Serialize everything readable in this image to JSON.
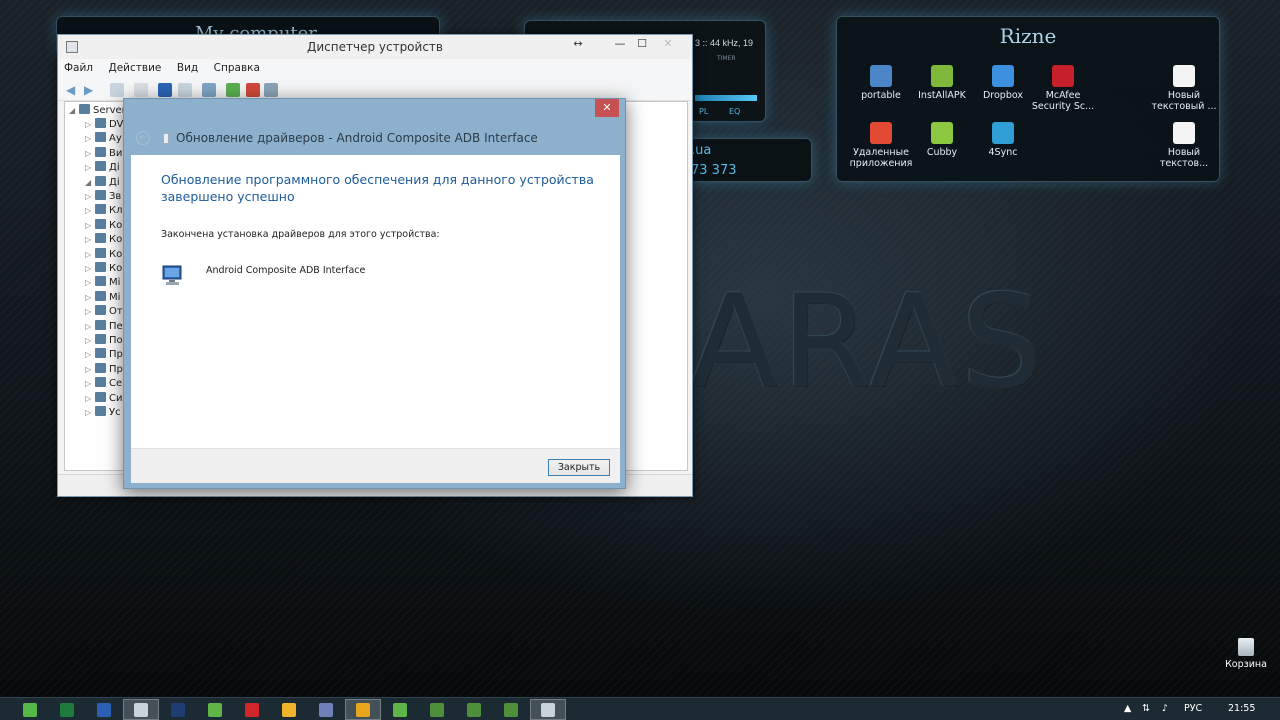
{
  "desktop": {
    "wallpaper_text": "ARAS",
    "recycle_bin_label": "Корзина"
  },
  "gadgets": {
    "my_computer_title": "My computer",
    "player": {
      "info": "3 :: 44 kHz, 19",
      "timer": "TIMER",
      "pl": "PL",
      "eq": "EQ"
    },
    "site": {
      "line1": ".ua",
      "line2": "73 373"
    },
    "rizne": {
      "title": "Rizne",
      "items": [
        {
          "label": "portable",
          "icon": "portable-icon",
          "color": "#4a86c8"
        },
        {
          "label": "InstAllAPK",
          "icon": "installapk-icon",
          "color": "#7fb83a"
        },
        {
          "label": "Dropbox",
          "icon": "dropbox-icon",
          "color": "#3d8fe0"
        },
        {
          "label": "McAfee Security Sc...",
          "icon": "mcafee-icon",
          "color": "#c8202a"
        },
        {
          "label": "Новый текстовый ...",
          "icon": "text-file-icon",
          "color": "#f4f4f4"
        },
        {
          "label": "Удаленные приложения",
          "icon": "chrome-icon",
          "color": "#e24a33"
        },
        {
          "label": "Cubby",
          "icon": "cubby-icon",
          "color": "#8dc63f"
        },
        {
          "label": "4Sync",
          "icon": "4sync-icon",
          "color": "#2f9fd6"
        },
        {
          "label": "Новый текстов...",
          "icon": "text-file-icon",
          "color": "#f4f4f4"
        }
      ]
    }
  },
  "devmgr": {
    "title": "Диспетчер устройств",
    "menu": [
      "Файл",
      "Действие",
      "Вид",
      "Справка"
    ],
    "tree_root": "Server",
    "tree_rows": [
      "DV",
      "Ау",
      "Ви",
      "Ді",
      "Ді",
      "Зв",
      "Кл",
      "Ко",
      "Ко",
      "Ко",
      "Ко",
      "Мі",
      "Мі",
      "От",
      "Пе",
      "По",
      "Пр",
      "Пр",
      "Се",
      "Си",
      "Ус"
    ]
  },
  "dialog": {
    "title": "Обновление драйверов - Android Composite ADB Interface",
    "heading": "Обновление программного обеспечения для данного устройства завершено успешно",
    "info": "Закончена установка драйверов для этого устройства:",
    "device_name": "Android Composite ADB Interface",
    "close_button": "Закрыть",
    "close_glyph": "✕"
  },
  "taskbar": {
    "apps": [
      {
        "icon": "utorrent-icon",
        "color": "#56b847"
      },
      {
        "icon": "excel-icon",
        "color": "#1f7a3e"
      },
      {
        "icon": "word-icon",
        "color": "#2b5fb4"
      },
      {
        "icon": "device-manager-icon",
        "color": "#c9d3da",
        "active": true
      },
      {
        "icon": "photoshop-icon",
        "color": "#1d3d73"
      },
      {
        "icon": "gear-green-icon",
        "color": "#5fb546"
      },
      {
        "icon": "opera-icon",
        "color": "#d3262b"
      },
      {
        "icon": "chrome-icon",
        "color": "#f1b32c"
      },
      {
        "icon": "save-icon",
        "color": "#6f7fb8"
      },
      {
        "icon": "avast-icon",
        "color": "#e7a61b",
        "active": true
      },
      {
        "icon": "gear-green-icon",
        "color": "#5fb546"
      },
      {
        "icon": "filezilla-icon",
        "color": "#4f8f3a"
      },
      {
        "icon": "filezilla-icon",
        "color": "#4f8f3a"
      },
      {
        "icon": "filezilla-icon",
        "color": "#4f8f3a"
      },
      {
        "icon": "window-icon",
        "color": "#c9d3da",
        "active": true
      }
    ],
    "lang": "РУС",
    "time": "21:55"
  }
}
